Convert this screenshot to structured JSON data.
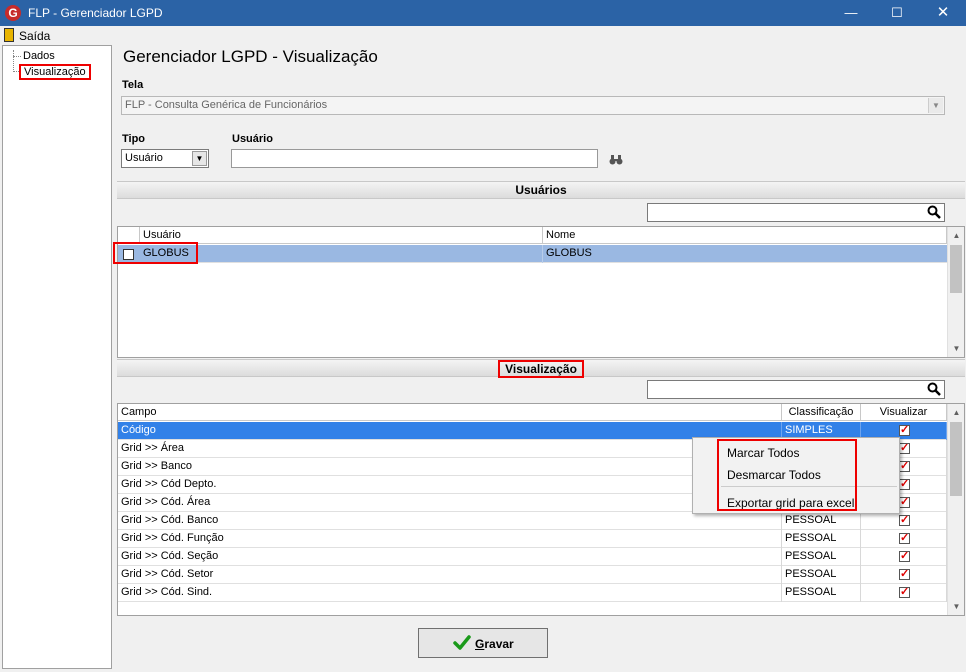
{
  "window": {
    "title": "FLP - Gerenciador LGPD",
    "app_icon_letter": "G",
    "minimize": "—",
    "maximize": "☐",
    "close": "✕"
  },
  "menu": {
    "exit_label": "Saída"
  },
  "tree": {
    "items": [
      "Dados",
      "Visualização"
    ]
  },
  "page_title": "Gerenciador LGPD - Visualização",
  "tela": {
    "label": "Tela",
    "value": "FLP - Consulta Genérica de Funcionários"
  },
  "tipo": {
    "label": "Tipo",
    "value": "Usuário"
  },
  "usuario": {
    "label": "Usuário",
    "value": ""
  },
  "usuarios_section": {
    "title": "Usuários",
    "search_value": "",
    "columns": [
      "Usuário",
      "Nome"
    ],
    "rows": [
      {
        "usuario": "GLOBUS",
        "nome": "GLOBUS",
        "checked": false
      }
    ]
  },
  "visualizacao_section": {
    "title": "Visualização",
    "search_value": "",
    "columns": [
      "Campo",
      "Classificação",
      "Visualizar"
    ],
    "rows": [
      {
        "campo": "Código",
        "classificacao": "SIMPLES",
        "visualizar": true
      },
      {
        "campo": "Grid >> Área",
        "classificacao": "",
        "visualizar": true
      },
      {
        "campo": "Grid >> Banco",
        "classificacao": "",
        "visualizar": true
      },
      {
        "campo": "Grid >> Cód Depto.",
        "classificacao": "",
        "visualizar": true
      },
      {
        "campo": "Grid >> Cód. Área",
        "classificacao": "",
        "visualizar": true
      },
      {
        "campo": "Grid >> Cód. Banco",
        "classificacao": "PESSOAL",
        "visualizar": true
      },
      {
        "campo": "Grid >> Cód. Função",
        "classificacao": "PESSOAL",
        "visualizar": true
      },
      {
        "campo": "Grid >> Cód. Seção",
        "classificacao": "PESSOAL",
        "visualizar": true
      },
      {
        "campo": "Grid >> Cód. Setor",
        "classificacao": "PESSOAL",
        "visualizar": true
      },
      {
        "campo": "Grid >> Cód. Sind.",
        "classificacao": "PESSOAL",
        "visualizar": true
      }
    ]
  },
  "context_menu": {
    "items": [
      "Marcar Todos",
      "Desmarcar Todos",
      "Exportar grid para excel"
    ]
  },
  "save_button": {
    "label_underlined": "G",
    "label_rest": "ravar"
  },
  "colors": {
    "titlebar": "#2b63a6",
    "selection": "#3281e8",
    "highlight_box": "#e00000",
    "check": "#d00000"
  }
}
